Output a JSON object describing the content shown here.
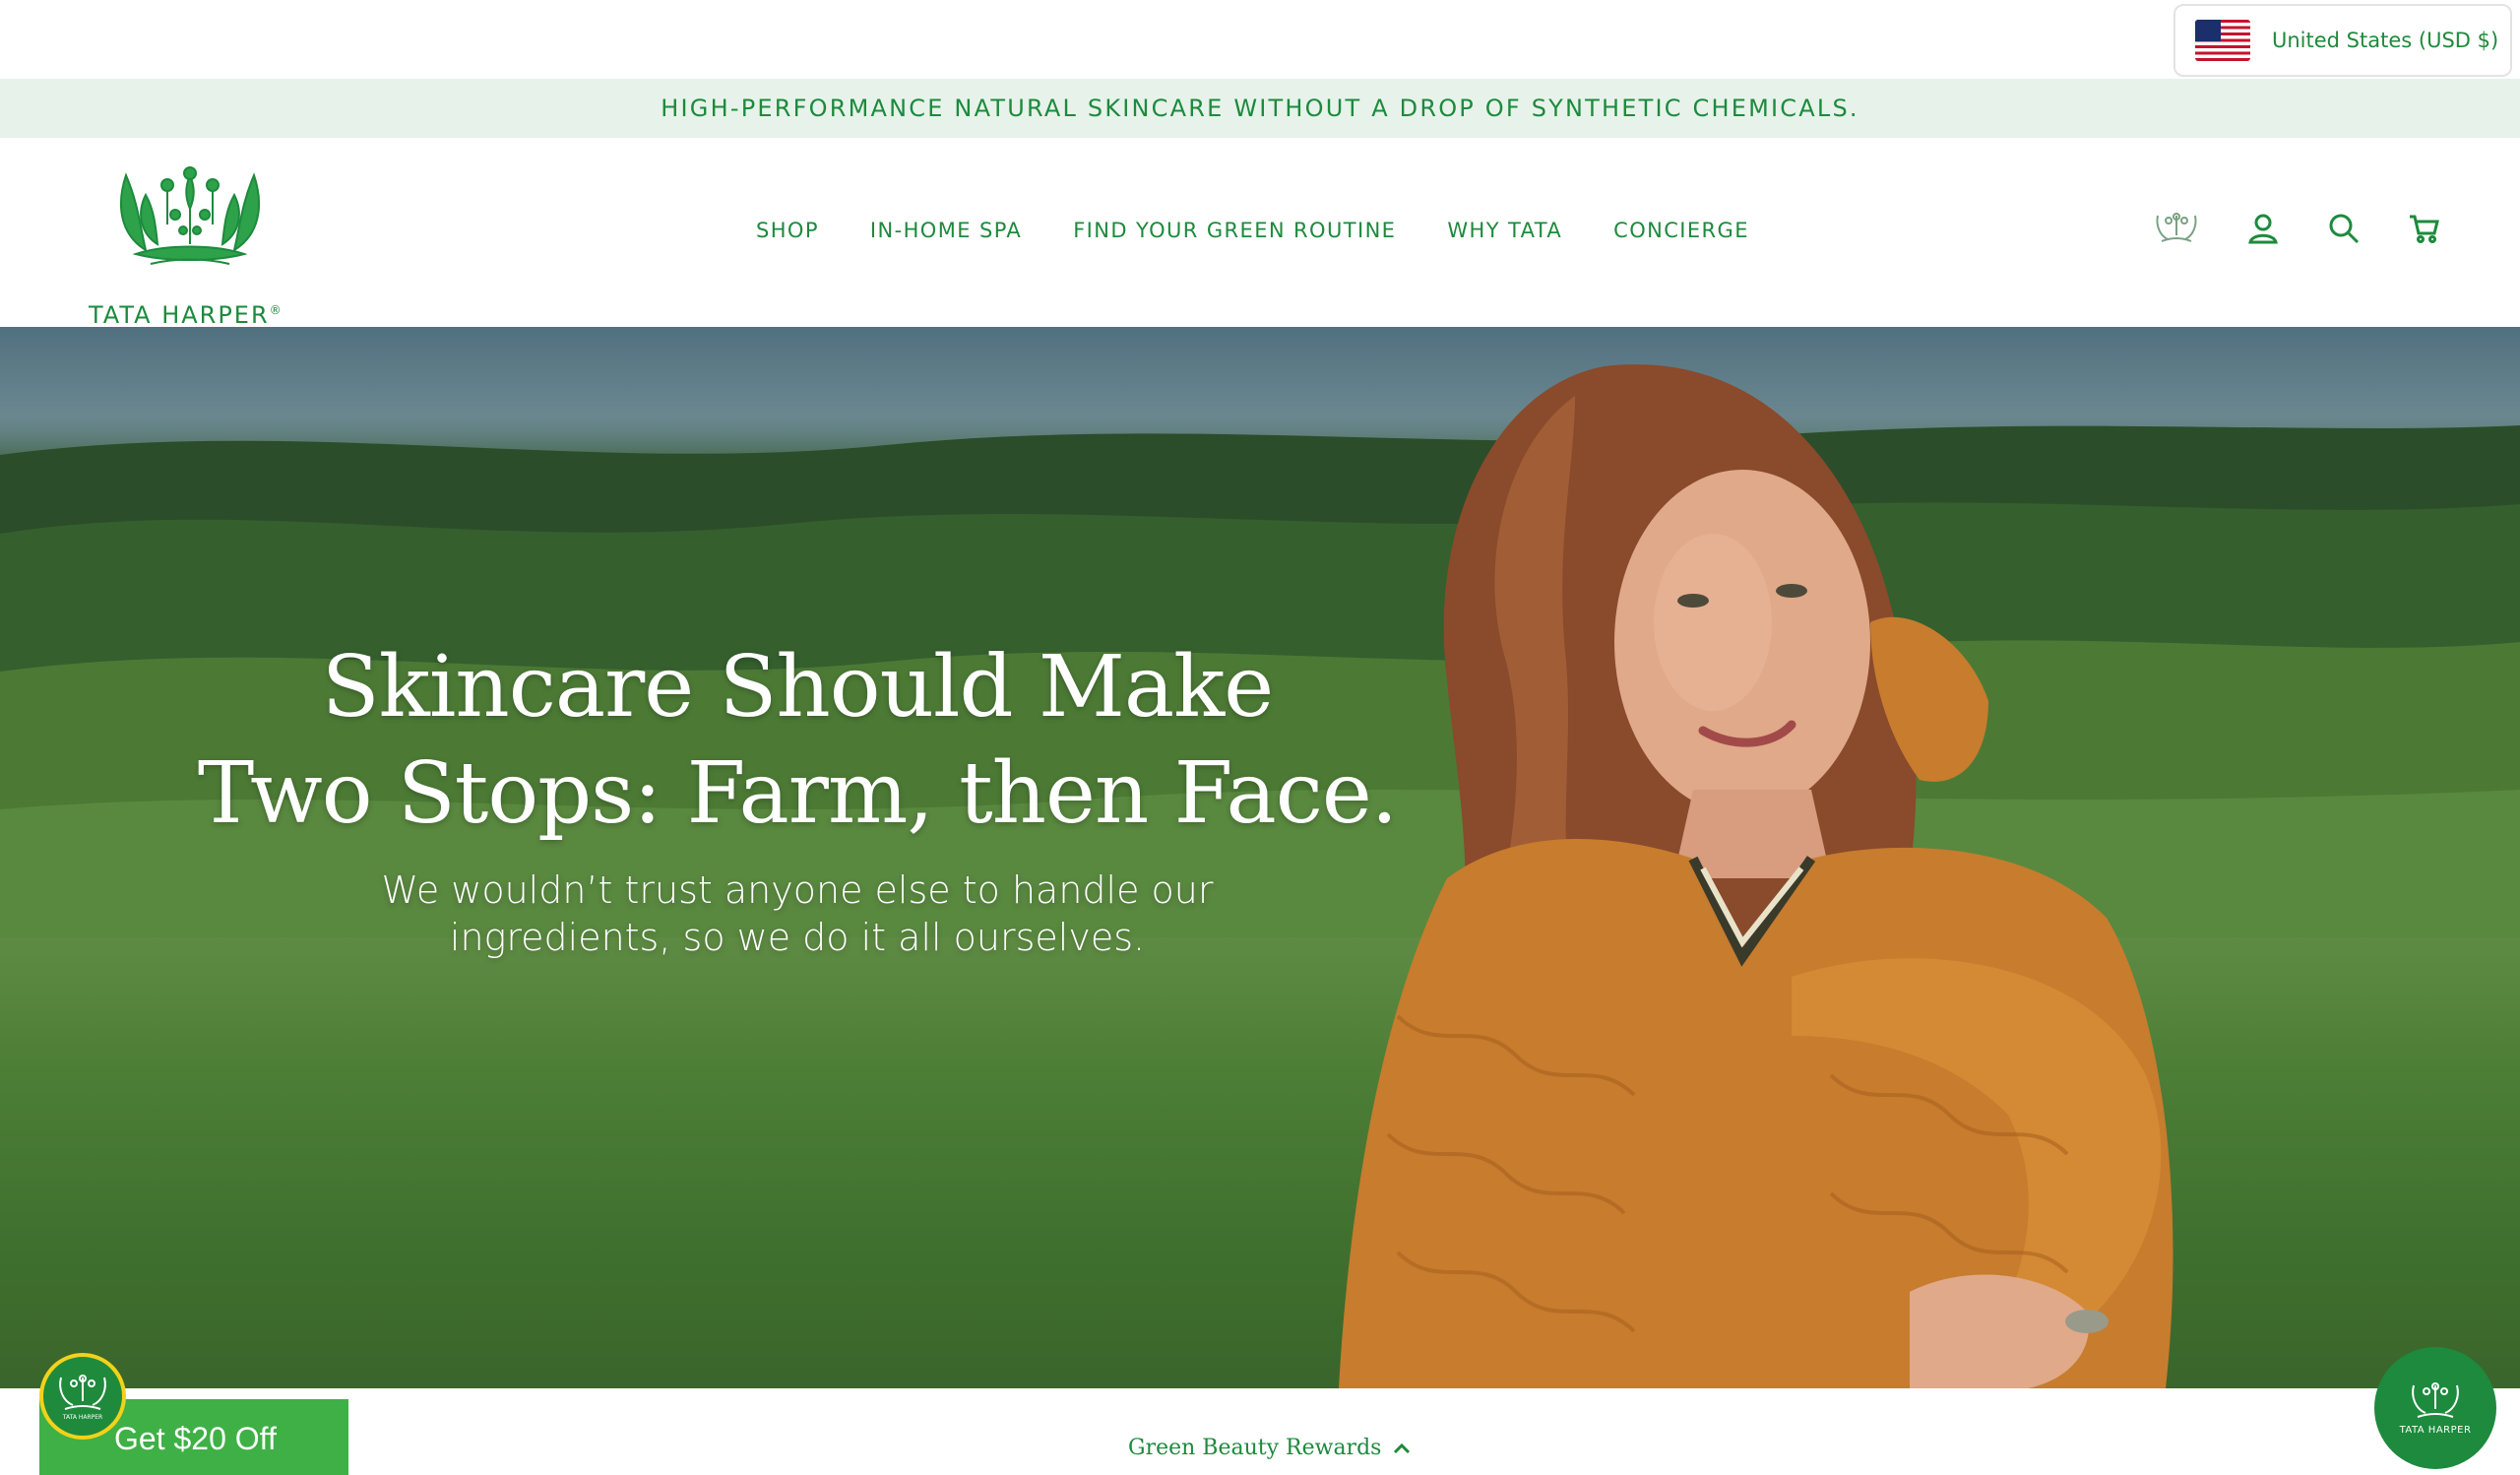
{
  "utility": {
    "country_label": "United States (USD $)",
    "flag": "us-flag-icon"
  },
  "announcement": "HIGH-PERFORMANCE NATURAL SKINCARE WITHOUT A DROP OF SYNTHETIC CHEMICALS.",
  "brand": {
    "name": "TATA HARPER",
    "trademark": "®",
    "accent": "#1d8a3d"
  },
  "nav": {
    "items": [
      {
        "label": "SHOP"
      },
      {
        "label": "IN-HOME SPA"
      },
      {
        "label": "FIND YOUR GREEN ROUTINE"
      },
      {
        "label": "WHY TATA"
      },
      {
        "label": "CONCIERGE"
      }
    ]
  },
  "header_icons": [
    "crest-icon",
    "account-icon",
    "search-icon",
    "cart-icon"
  ],
  "hero": {
    "title_line1": "Skincare Should Make",
    "title_line2": "Two Stops: Farm, then Face.",
    "subtitle_line1": "We wouldn’t trust anyone else to handle our",
    "subtitle_line2": "ingredients, so we do it all ourselves."
  },
  "footer_bar": {
    "rewards_label": "Green Beauty Rewards",
    "offer_label": "Get $20 Off",
    "badge_text": "TATA HARPER",
    "chat_text": "TATA HARPER"
  },
  "colors": {
    "announce_bg": "#e7f3ea",
    "offer_green": "#3fb046",
    "badge_ring": "#f2d21a"
  }
}
